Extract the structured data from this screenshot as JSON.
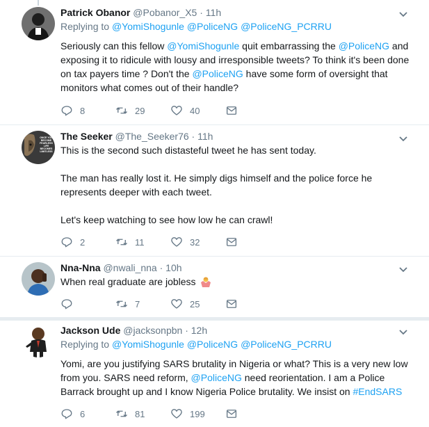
{
  "tweets": [
    {
      "name": "Patrick Obanor",
      "handle": "@Pobanor_X5",
      "sep": " · ",
      "time": "11h",
      "replying_prefix": "Replying to ",
      "replying_to": [
        "@YomiShogunle",
        "@PoliceNG",
        "@PoliceNG_PCRRU"
      ],
      "text_parts": [
        {
          "t": "Seriously can this fellow  ",
          "m": false
        },
        {
          "t": "@YomiShogunle",
          "m": true
        },
        {
          "t": " quit embarrassing the ",
          "m": false
        },
        {
          "t": "@PoliceNG",
          "m": true
        },
        {
          "t": " and exposing it to ridicule with lousy and irresponsible tweets? To think it's been done on tax payers time ? Don't the ",
          "m": false
        },
        {
          "t": "@PoliceNG",
          "m": true
        },
        {
          "t": " have some form of oversight that monitors what comes out of their handle?",
          "m": false
        }
      ],
      "replies": "8",
      "retweets": "29",
      "likes": "40"
    },
    {
      "name": "The Seeker",
      "handle": "@The_Seeker76",
      "sep": " · ",
      "time": "11h",
      "paragraphs": [
        "This is the second such distasteful tweet he has sent today.",
        "The man has really lost it. He simply digs himself and the police force he represents deeper with each tweet.",
        "Let's keep watching to see how low he can crawl!"
      ],
      "replies": "2",
      "retweets": "11",
      "likes": "32",
      "avatar_text": "ONCE YOU BECOME FEARLESS LIFE BECOMES LIMITLESS"
    },
    {
      "name": "Nna-Nna",
      "handle": "@nwali_nna",
      "sep": " · ",
      "time": "10h",
      "text": "When real graduate are jobless",
      "emoji": "person-shrugging-emoji",
      "replies": "",
      "retweets": "7",
      "likes": "25"
    },
    {
      "name": "Jackson Ude",
      "handle": "@jacksonpbn",
      "sep": " · ",
      "time": "12h",
      "replying_prefix": "Replying to ",
      "replying_to": [
        "@YomiShogunle",
        "@PoliceNG",
        "@PoliceNG_PCRRU"
      ],
      "text_parts": [
        {
          "t": "Yomi, are you justifying SARS brutality in Nigeria or what? This is a very new low from you. SARS need reform, ",
          "m": false
        },
        {
          "t": "@PoliceNG",
          "m": true
        },
        {
          "t": " need reorientation. I am a Police Barrack brought up and I know Nigeria Police brutality. We insist on ",
          "m": false
        },
        {
          "t": "#EndSARS",
          "m": true
        }
      ],
      "replies": "6",
      "retweets": "81",
      "likes": "199"
    }
  ],
  "colors": {
    "accent": "#1da1f2",
    "muted": "#657786",
    "text": "#14171a",
    "divider": "#e6ecf0"
  },
  "icons": [
    "reply-icon",
    "retweet-icon",
    "like-icon",
    "dm-icon",
    "chevron-down-icon"
  ]
}
